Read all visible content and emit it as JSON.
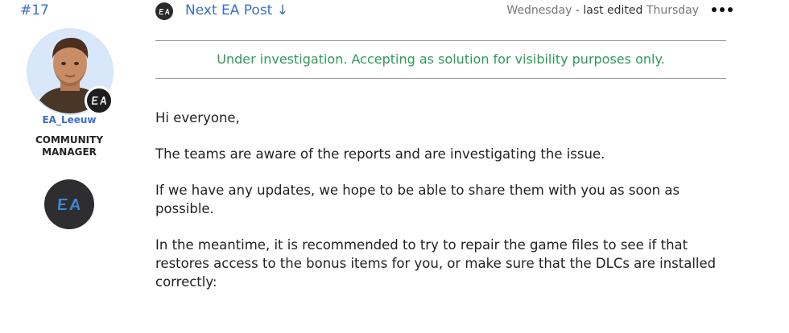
{
  "post": {
    "number": "#17",
    "next_post_label": "Next EA Post ↓",
    "posted": "Wednesday",
    "separator": "-",
    "edited_label": "last edited",
    "edited": "Thursday",
    "status": "Under investigation. Accepting as solution for visibility purposes only.",
    "paragraphs": [
      "Hi everyone,",
      "The teams are aware of the reports and are investigating the issue.",
      "If we have any updates, we hope to be able to share them with you as soon as possible.",
      "In the meantime, it is recommended to try to repair the game files to see if that restores access to the bonus items for you, or make sure that the DLCs are installed correctly:"
    ]
  },
  "author": {
    "name": "EA_Leeuw",
    "rank_line1": "COMMUNITY",
    "rank_line2": "MANAGER",
    "badge_text": "EA"
  },
  "icons": {
    "header": "ea-logo-icon",
    "more": "more-options-icon",
    "avatar_badge": "ea-badge-icon",
    "rank": "ea-rank-icon"
  },
  "colors": {
    "link": "#3b6fc9",
    "status": "#2e9a5a",
    "text": "#222222",
    "muted": "#777777"
  }
}
